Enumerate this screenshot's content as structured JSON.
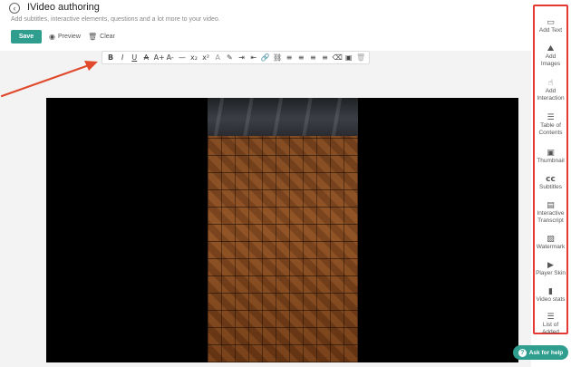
{
  "header": {
    "back_icon": "arrow-left-circle-icon",
    "title": "IVideo authoring",
    "subtitle": "Add subtitles, interactive elements, questions and a lot more to your video.",
    "save_label": "Save",
    "preview_label": "Preview",
    "clear_label": "Clear"
  },
  "toolbar": {
    "buttons": [
      {
        "name": "bold",
        "glyph": "B"
      },
      {
        "name": "italic",
        "glyph": "I"
      },
      {
        "name": "underline",
        "glyph": "U"
      },
      {
        "name": "strikethrough",
        "glyph": "A"
      },
      {
        "name": "font-size-up",
        "glyph": "A+"
      },
      {
        "name": "font-size-down",
        "glyph": "A-"
      },
      {
        "name": "horizontal-rule",
        "glyph": "—"
      },
      {
        "name": "subscript",
        "glyph": "x₂"
      },
      {
        "name": "superscript",
        "glyph": "x²"
      },
      {
        "name": "font-color",
        "glyph": "A"
      },
      {
        "name": "highlight",
        "glyph": "✎"
      },
      {
        "name": "indent",
        "glyph": "⇥"
      },
      {
        "name": "outdent",
        "glyph": "⇤"
      },
      {
        "name": "link",
        "glyph": "🔗"
      },
      {
        "name": "unlink",
        "glyph": "⛓"
      },
      {
        "name": "align-left",
        "glyph": "≡"
      },
      {
        "name": "align-center",
        "glyph": "≡"
      },
      {
        "name": "align-right",
        "glyph": "≡"
      },
      {
        "name": "align-justify",
        "glyph": "≡"
      },
      {
        "name": "clear-format",
        "glyph": "⌫"
      },
      {
        "name": "image",
        "glyph": "▣"
      },
      {
        "name": "delete",
        "glyph": "🗑"
      }
    ]
  },
  "sidebar": {
    "items": [
      {
        "name": "add-text",
        "icon": "comment-icon",
        "glyph": "▭",
        "label": "Add Text"
      },
      {
        "name": "add-images",
        "icon": "image-icon",
        "glyph": "⛰",
        "label": "Add Images"
      },
      {
        "name": "add-interaction",
        "icon": "touch-icon",
        "glyph": "☝",
        "label": "Add Interaction"
      },
      {
        "name": "table-of-contents",
        "icon": "list-icon",
        "glyph": "☰",
        "label": "Table of Contents"
      },
      {
        "name": "thumbnail",
        "icon": "picture-icon",
        "glyph": "▣",
        "label": "Thumbnail"
      },
      {
        "name": "subtitles",
        "icon": "closed-caption-icon",
        "glyph": "cc",
        "label": "Subtitles"
      },
      {
        "name": "interactive-transcript",
        "icon": "transcript-icon",
        "glyph": "▤",
        "label": "Interactive Transcript"
      },
      {
        "name": "watermark",
        "icon": "watermark-icon",
        "glyph": "▨",
        "label": "Watermark"
      },
      {
        "name": "player-skin",
        "icon": "play-box-icon",
        "glyph": "▶",
        "label": "Player Skin"
      },
      {
        "name": "video-stats",
        "icon": "bar-chart-icon",
        "glyph": "▮",
        "label": "Video stats"
      },
      {
        "name": "list-of-added",
        "icon": "list-icon",
        "glyph": "☰",
        "label": "List of Added"
      }
    ]
  },
  "help": {
    "label": "Ask for help",
    "icon": "question-icon"
  },
  "colors": {
    "accent": "#2f9e8f",
    "highlight": "#e53935"
  }
}
